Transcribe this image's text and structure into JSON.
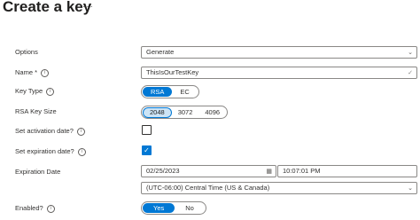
{
  "header": {
    "title": "Create a key",
    "more_glyph": "···"
  },
  "form": {
    "options": {
      "label": "Options",
      "value": "Generate",
      "chevron": "⌄"
    },
    "name": {
      "label": "Name *",
      "info": "i",
      "value": "ThisIsOurTestKey",
      "valid_glyph": "✓"
    },
    "key_type": {
      "label": "Key Type",
      "info": "i",
      "options": [
        "RSA",
        "EC"
      ],
      "selected": "RSA"
    },
    "rsa_key_size": {
      "label": "RSA Key Size",
      "options": [
        "2048",
        "3072",
        "4096"
      ],
      "selected": "2048"
    },
    "activation": {
      "label": "Set activation date?",
      "info": "i",
      "checked": false
    },
    "expiration": {
      "label": "Set expiration date?",
      "info": "i",
      "checked": true,
      "check_glyph": "✓"
    },
    "expiration_date": {
      "label": "Expiration Date",
      "date": "02/25/2023",
      "time": "10:07:01 PM",
      "timezone": "(UTC-06:00) Central Time (US & Canada)",
      "calendar_glyph": "▦",
      "chevron": "⌄"
    },
    "enabled": {
      "label": "Enabled?",
      "info": "i",
      "options": [
        "Yes",
        "No"
      ],
      "selected": "Yes"
    }
  },
  "colors": {
    "accent": "#0078d4",
    "text": "#323130",
    "border": "#8a8886",
    "selected_soft": "#cce4f6"
  }
}
